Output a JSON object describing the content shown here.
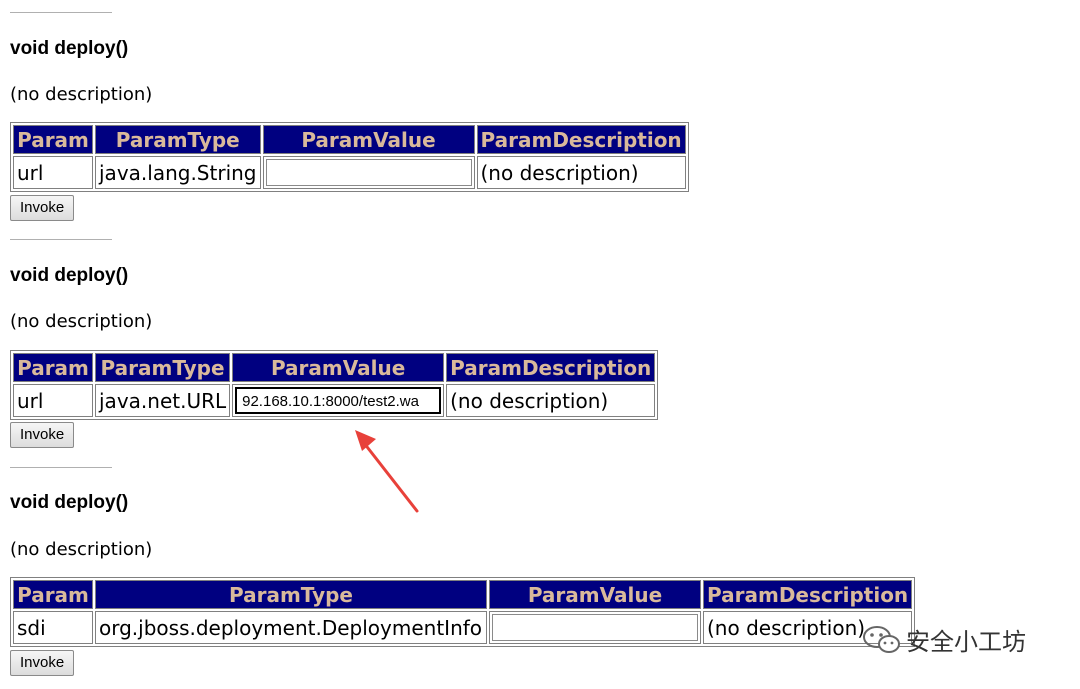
{
  "operations": [
    {
      "title": "void deploy()",
      "description": "(no description)",
      "headers": [
        "Param",
        "ParamType",
        "ParamValue",
        "ParamDescription"
      ],
      "param": "url",
      "param_type": "java.lang.String",
      "param_value": "",
      "param_description": "(no description)",
      "invoke_label": "Invoke"
    },
    {
      "title": "void deploy()",
      "description": "(no description)",
      "headers": [
        "Param",
        "ParamType",
        "ParamValue",
        "ParamDescription"
      ],
      "param": "url",
      "param_type": "java.net.URL",
      "param_value": "92.168.10.1:8000/test2.wa",
      "param_description": "(no description)",
      "invoke_label": "Invoke"
    },
    {
      "title": "void deploy()",
      "description": "(no description)",
      "headers": [
        "Param",
        "ParamType",
        "ParamValue",
        "ParamDescription"
      ],
      "param": "sdi",
      "param_type": "org.jboss.deployment.DeploymentInfo",
      "param_value": "",
      "param_description": "(no description)",
      "invoke_label": "Invoke"
    }
  ],
  "watermark": {
    "text": "安全小工坊",
    "icon": "wechat-icon"
  },
  "colors": {
    "header_bg": "#000080",
    "header_text": "#d9b99b",
    "arrow": "#e8413a"
  }
}
